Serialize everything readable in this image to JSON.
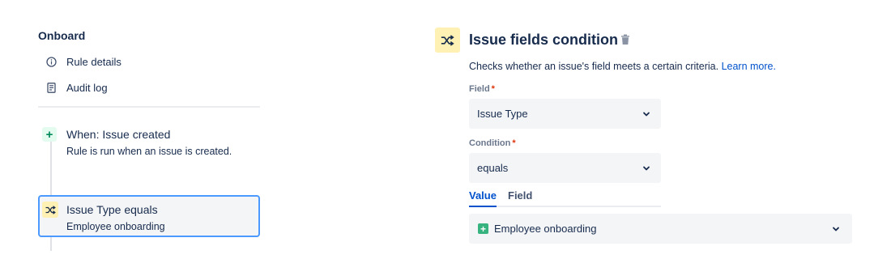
{
  "sidebar": {
    "rule_name": "Onboard",
    "nav": [
      {
        "label": "Rule details",
        "icon": "info-icon"
      },
      {
        "label": "Audit log",
        "icon": "document-icon"
      }
    ],
    "trigger": {
      "title": "When: Issue created",
      "subtitle": "Rule is run when an issue is created.",
      "icon": "plus-icon"
    },
    "condition": {
      "title": "Issue Type equals",
      "subtitle": "Employee onboarding",
      "icon": "shuffle-icon"
    }
  },
  "panel": {
    "title": "Issue fields condition",
    "icon": "shuffle-icon",
    "description": "Checks whether an issue's field meets a certain criteria.",
    "learn_more": "Learn more.",
    "field_label": "Field",
    "field_value": "Issue Type",
    "condition_label": "Condition",
    "condition_value": "equals",
    "required_marker": "*",
    "tabs": [
      {
        "label": "Value",
        "active": true
      },
      {
        "label": "Field",
        "active": false
      }
    ],
    "value_selected": "Employee onboarding"
  },
  "colors": {
    "accent": "#0052cc",
    "focus_border": "#4c9aff",
    "condition_badge": "#fff0b3",
    "trigger_badge": "#e3fcef",
    "required": "#de350b",
    "success": "#36b37e"
  }
}
